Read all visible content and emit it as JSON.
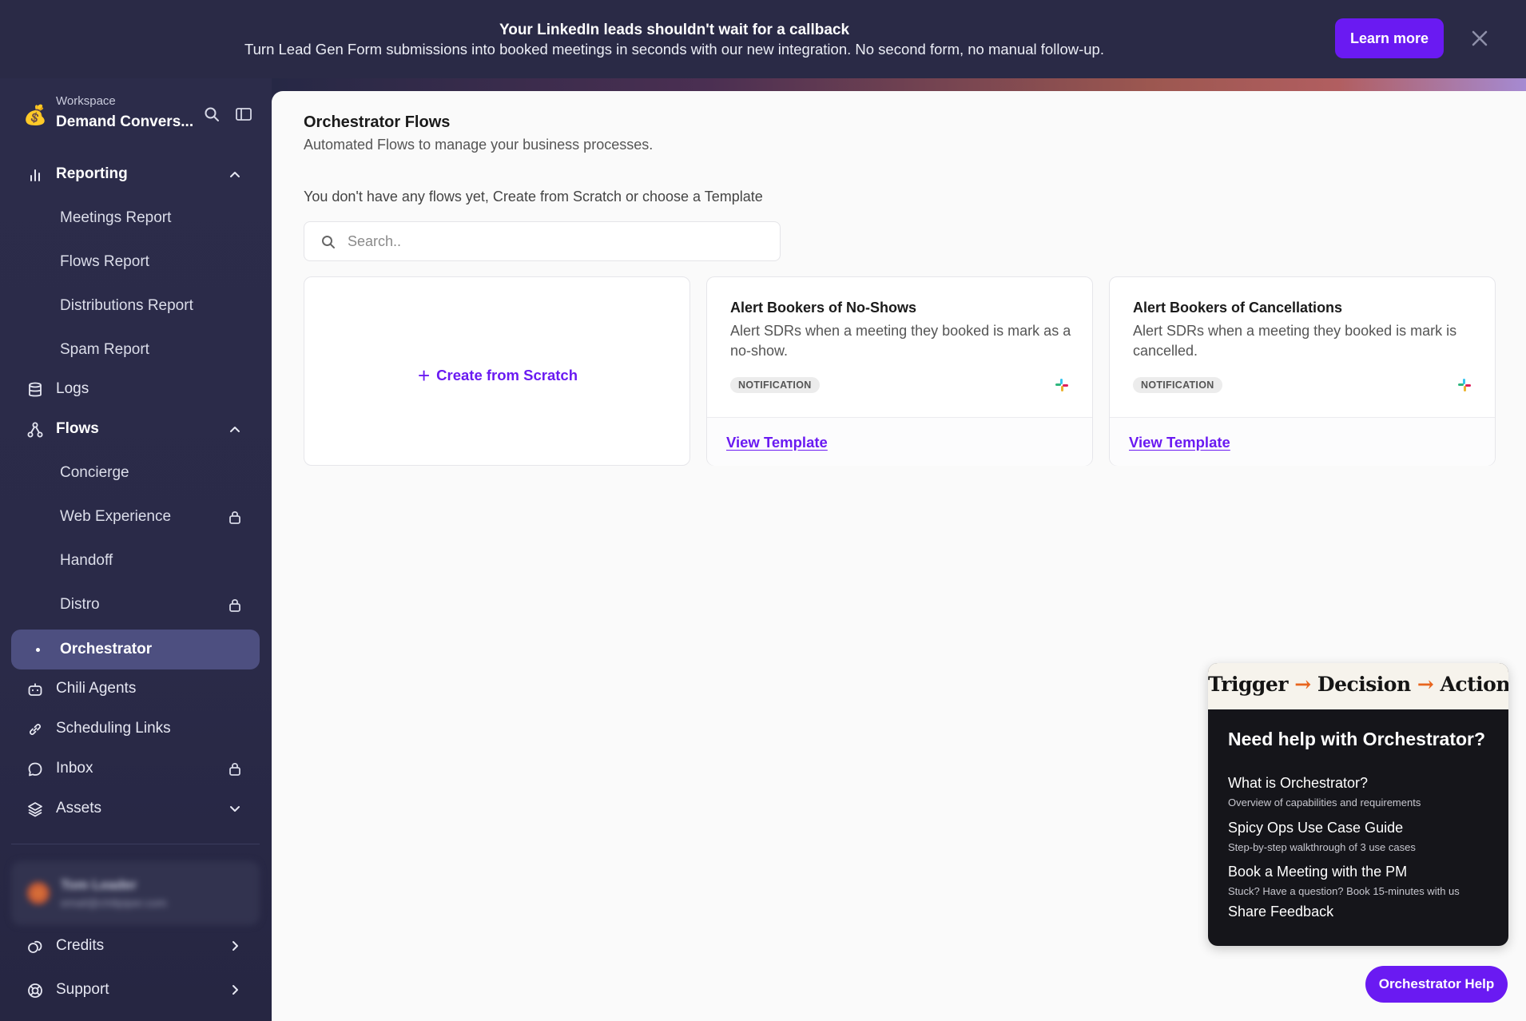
{
  "banner": {
    "title": "Your LinkedIn leads shouldn't wait for a callback",
    "subtitle": "Turn Lead Gen Form submissions into booked meetings in seconds with our new integration. No second form, no manual follow-up.",
    "cta_label": "Learn more",
    "accent_color": "#6a1af2"
  },
  "workspace": {
    "caption": "Workspace",
    "name": "Demand Convers...",
    "logo_icon": "money-bag-icon"
  },
  "sidebar": {
    "reporting": {
      "label": "Reporting",
      "items": [
        "Meetings Report",
        "Flows Report",
        "Distributions Report",
        "Spam Report"
      ]
    },
    "logs": "Logs",
    "flows": {
      "label": "Flows",
      "items": [
        {
          "label": "Concierge",
          "locked": false
        },
        {
          "label": "Web Experience",
          "locked": true
        },
        {
          "label": "Handoff",
          "locked": false
        },
        {
          "label": "Distro",
          "locked": true
        },
        {
          "label": "Orchestrator",
          "locked": false,
          "active": true
        }
      ]
    },
    "chili_agents": "Chili Agents",
    "scheduling_links": "Scheduling Links",
    "inbox": {
      "label": "Inbox",
      "locked": true
    },
    "assets": "Assets",
    "credits": "Credits",
    "support": "Support",
    "user": {
      "name": "Tom Leader",
      "email": "email@chilipiper.com"
    }
  },
  "main": {
    "title": "Orchestrator Flows",
    "subtitle": "Automated Flows to manage your business processes.",
    "empty_note": "You don't have any flows yet, Create from Scratch or choose a Template",
    "search_placeholder": "Search..",
    "create_label": "Create from Scratch",
    "templates": [
      {
        "title": "Alert Bookers of No-Shows",
        "description": "Alert SDRs when a meeting they booked is mark as a no-show.",
        "badge": "NOTIFICATION",
        "link": "View Template"
      },
      {
        "title": "Alert Bookers of Cancellations",
        "description": "Alert SDRs when a meeting they booked is mark is cancelled.",
        "badge": "NOTIFICATION",
        "link": "View Template"
      }
    ]
  },
  "help": {
    "hero": {
      "trigger": "Trigger",
      "decision": "Decision",
      "action": "Action",
      "arrow": "→"
    },
    "title": "Need help with Orchestrator?",
    "links": [
      {
        "label": "What is Orchestrator?",
        "sub": "Overview of capabilities and requirements"
      },
      {
        "label": "Spicy Ops Use Case Guide",
        "sub": "Step-by-step walkthrough of 3 use cases"
      },
      {
        "label": "Book a Meeting with the PM",
        "sub": "Stuck? Have a question? Book 15-minutes with us"
      },
      {
        "label": "Share Feedback",
        "sub": ""
      }
    ],
    "button_label": "Orchestrator Help"
  }
}
